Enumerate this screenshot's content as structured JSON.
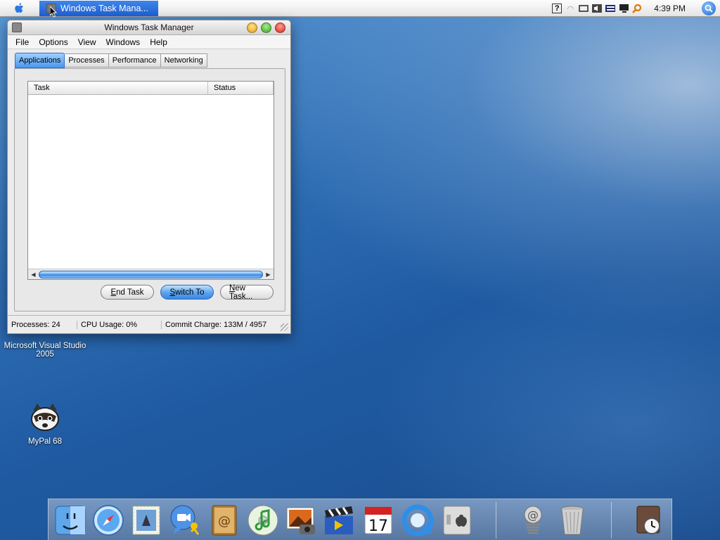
{
  "menubar": {
    "active_app": "Windows Task Mana...",
    "clock": "4:39 PM"
  },
  "window": {
    "title": "Windows Task Manager",
    "menu": [
      "File",
      "Options",
      "View",
      "Windows",
      "Help"
    ],
    "tabs": [
      "Applications",
      "Processes",
      "Performance",
      "Networking"
    ],
    "active_tab": "Applications",
    "columns": [
      "Task",
      "Status"
    ],
    "buttons": {
      "end_task": "End Task",
      "switch_to": "Switch To",
      "new_task": "New Task..."
    },
    "status": {
      "processes": "Processes: 24",
      "cpu": "CPU Usage: 0%",
      "commit": "Commit Charge: 133M / 4957"
    }
  },
  "desktop": {
    "icons": [
      {
        "label": "Microsoft Visual Studio 2005"
      },
      {
        "label": "MyPal 68"
      }
    ]
  },
  "dock": {
    "items": [
      "finder",
      "safari",
      "mail",
      "ichat",
      "address-book",
      "itunes",
      "iphoto",
      "imovie",
      "ical",
      "quicktime",
      "system-preferences",
      "mail-stamp",
      "trash",
      "timer-app"
    ]
  },
  "colors": {
    "accent": "#3b88e3",
    "menubar_highlight": "#1d5fd3",
    "desktop": "#1f5aa1"
  }
}
